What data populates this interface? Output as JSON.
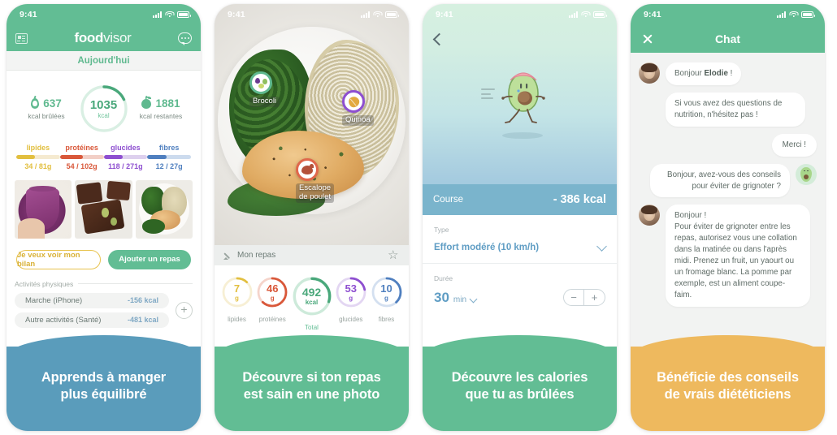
{
  "colors": {
    "brand_green": "#62bd94",
    "caption_blue": "#5a9cbb",
    "caption_green": "#62bd94",
    "caption_amber": "#eeb95e",
    "course_blue": "#7ab4cc",
    "lipides": "#e2bf3f",
    "proteines": "#d9583a",
    "glucides": "#8e4fd0",
    "fibres": "#4f7fbf",
    "total_green": "#4aa87b"
  },
  "status_bar": {
    "time": "9:41",
    "signal_icon": "signal-bars-icon",
    "wifi_icon": "wifi-icon",
    "battery_icon": "battery-icon"
  },
  "panel1": {
    "header": {
      "left_icon": "newspaper-icon",
      "brand_bold": "food",
      "brand_light": "visor",
      "right_icon": "chat-bubble-icon"
    },
    "day_tab": "Aujourd'hui",
    "burned": {
      "icon": "flame-icon",
      "value": "637",
      "label": "kcal brûlées"
    },
    "remaining": {
      "icon": "apple-icon",
      "value": "1881",
      "label": "kcal restantes"
    },
    "ring": {
      "value": "1035",
      "unit": "kcal",
      "percent": 18
    },
    "macros": [
      {
        "name": "lipides",
        "value": "34 / 81g",
        "color": "#e2bf3f",
        "track": "#f5ead0",
        "percent": 42
      },
      {
        "name": "protéines",
        "value": "54 / 102g",
        "color": "#d9583a",
        "track": "#f2cfc6",
        "percent": 53
      },
      {
        "name": "glucides",
        "value": "118 / 271g",
        "color": "#8e4fd0",
        "track": "#ddd0ee",
        "percent": 44
      },
      {
        "name": "fibres",
        "value": "12 / 27g",
        "color": "#4f7fbf",
        "track": "#ccdbee",
        "percent": 44
      }
    ],
    "thumbnails": [
      "smoothie-thumbnail",
      "brownie-thumbnail",
      "chicken-quinoa-thumbnail"
    ],
    "buttons": {
      "outline": "Je veux voir mon bilan",
      "filled": "Ajouter un repas"
    },
    "activities_label": "Activités physiques",
    "activities": [
      {
        "name": "Marche (iPhone)",
        "kcal": "-156 kcal"
      },
      {
        "name": "Autre activités (Santé)",
        "kcal": "-481 kcal"
      }
    ],
    "add_activity_icon": "plus-icon",
    "caption": "Apprends à manger\nplus équilibré"
  },
  "panel2": {
    "photo_name": "meal-photo-chicken-broccoli-quinoa",
    "markers": [
      {
        "label": "Brocoli",
        "icon": "vegetables-icon",
        "color": "#5fb98f"
      },
      {
        "label": "Quinoa",
        "icon": "grain-icon",
        "color": "#8e4fd0"
      },
      {
        "label": "Escalope\nde poulet",
        "icon": "meat-icon",
        "color": "#e0674b"
      }
    ],
    "meal_bar": {
      "edit_icon": "pencil-icon",
      "title": "Mon repas",
      "favorite_icon": "star-icon"
    },
    "rings": [
      {
        "value": "7",
        "unit": "g",
        "caption": "lipides",
        "color": "#e2bf3f",
        "track": "#f7efd4",
        "percent": 12
      },
      {
        "value": "46",
        "unit": "g",
        "caption": "protéines",
        "color": "#d9583a",
        "track": "#f5d4cb",
        "percent": 62
      },
      {
        "value": "492",
        "unit": "kcal",
        "caption": "Total",
        "color": "#4aa87b",
        "track": "#cdeada",
        "percent": 30
      },
      {
        "value": "53",
        "unit": "g",
        "caption": "glucides",
        "color": "#8e4fd0",
        "track": "#e3d6f2",
        "percent": 22
      },
      {
        "value": "10",
        "unit": "g",
        "caption": "fibres",
        "color": "#4f7fbf",
        "track": "#d4e0f0",
        "percent": 38
      }
    ],
    "caption": "Découvre si ton repas\nest sain en une photo"
  },
  "panel3": {
    "back_icon": "back-chevron-icon",
    "mascot": "running-avocado-mascot",
    "summary": {
      "activity": "Course",
      "calories": "- 386 kcal"
    },
    "type_field": {
      "label": "Type",
      "value": "Effort modéré (10 km/h)",
      "dropdown_icon": "chevron-down-icon"
    },
    "duration_field": {
      "label": "Durée",
      "value": "30",
      "unit": "min",
      "dropdown_icon": "chevron-down-icon",
      "minus": "−",
      "plus": "+"
    },
    "caption": "Découvre les calories\nque tu as brûlées"
  },
  "panel4": {
    "header": {
      "close_icon": "close-icon",
      "title": "Chat"
    },
    "messages": [
      {
        "from": "coach",
        "avatar": "coach-avatar",
        "text_prefix": "Bonjour ",
        "text_bold": "Elodie",
        "text_suffix": " !"
      },
      {
        "from": "coach",
        "avatar": null,
        "text": "Si vous avez des questions de nutrition, n'hésitez pas !"
      },
      {
        "from": "user",
        "avatar": null,
        "text": "Merci !"
      },
      {
        "from": "user",
        "avatar": "avocado-avatar",
        "text": "Bonjour, avez-vous des conseils pour éviter de grignoter ?"
      },
      {
        "from": "coach",
        "avatar": "coach-avatar",
        "text": "Bonjour !\nPour éviter de grignoter entre les repas, autorisez vous une collation dans la matinée ou dans l'après midi. Prenez un fruit, un yaourt ou un fromage blanc. La pomme par exemple, est un aliment coupe-faim."
      }
    ],
    "caption": "Bénéficie des conseils\nde vrais diététiciens"
  }
}
